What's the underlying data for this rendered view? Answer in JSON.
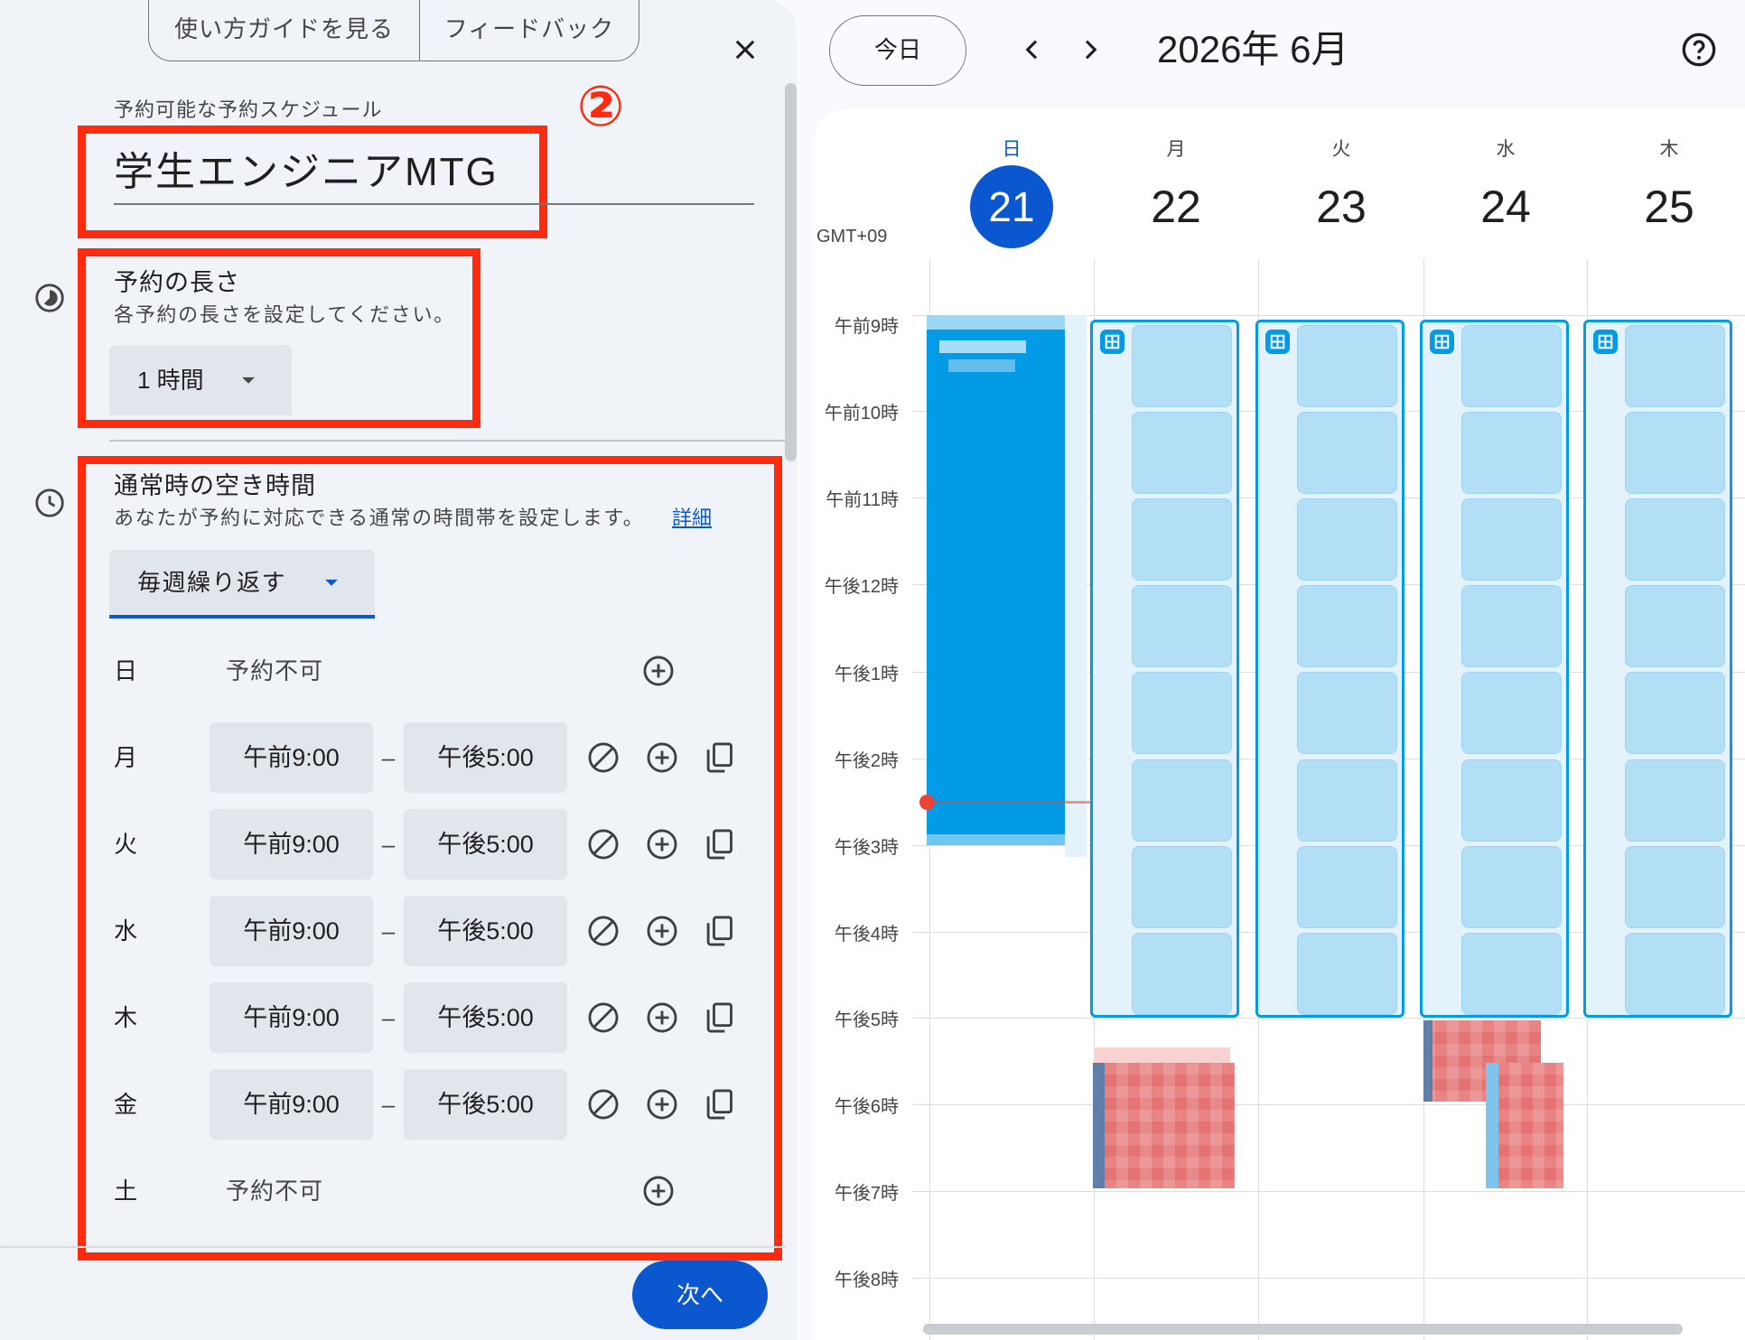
{
  "guide_tabs": {
    "guide": "使い方ガイドを見る",
    "feedback": "フィードバック"
  },
  "panel": {
    "section_label": "予約可能な予約スケジュール",
    "step_marker": "②",
    "title": "学生エンジニアMTG",
    "duration": {
      "heading": "予約の長さ",
      "description": "各予約の長さを設定してください。",
      "value": "1 時間"
    },
    "availability": {
      "heading": "通常時の空き時間",
      "description": "あなたが予約に対応できる通常の時間帯を設定します。",
      "details_link": "詳細",
      "repeat": "毎週繰り返す",
      "range_separator": "–",
      "days": [
        {
          "day": "日",
          "status": "予約不可"
        },
        {
          "day": "月",
          "start": "午前9:00",
          "end": "午後5:00"
        },
        {
          "day": "火",
          "start": "午前9:00",
          "end": "午後5:00"
        },
        {
          "day": "水",
          "start": "午前9:00",
          "end": "午後5:00"
        },
        {
          "day": "木",
          "start": "午前9:00",
          "end": "午後5:00"
        },
        {
          "day": "金",
          "start": "午前9:00",
          "end": "午後5:00"
        },
        {
          "day": "土",
          "status": "予約不可"
        }
      ]
    },
    "next_button": "次へ"
  },
  "calendar": {
    "today_button": "今日",
    "month_label": "2026年 6月",
    "timezone": "GMT+09",
    "days": [
      {
        "weekday": "日",
        "date": "21",
        "is_today": true
      },
      {
        "weekday": "月",
        "date": "22"
      },
      {
        "weekday": "火",
        "date": "23"
      },
      {
        "weekday": "水",
        "date": "24"
      },
      {
        "weekday": "木",
        "date": "25"
      }
    ],
    "hours": [
      "午前9時",
      "午前10時",
      "午前11時",
      "午後12時",
      "午後1時",
      "午後2時",
      "午後3時",
      "午後4時",
      "午後5時",
      "午後6時",
      "午後7時",
      "午後8時"
    ]
  },
  "colors": {
    "accent": "#0b57d0",
    "event": "#039be5",
    "annotation": "#ff2b0f",
    "availability_slot": "#b3dff6",
    "busy_event": "#e57373",
    "current_time": "#ea4335"
  },
  "icons": {
    "close": "close-icon",
    "duration": "timelapse-icon",
    "availability": "schedule-icon",
    "add": "add-circle-icon",
    "unavailable": "block-icon",
    "copy": "copy-icon",
    "dropdown": "arrow-drop-down-icon",
    "previous": "chevron-left-icon",
    "next": "chevron-right-icon",
    "help": "help-icon",
    "appointment": "appointment-grid-icon"
  }
}
